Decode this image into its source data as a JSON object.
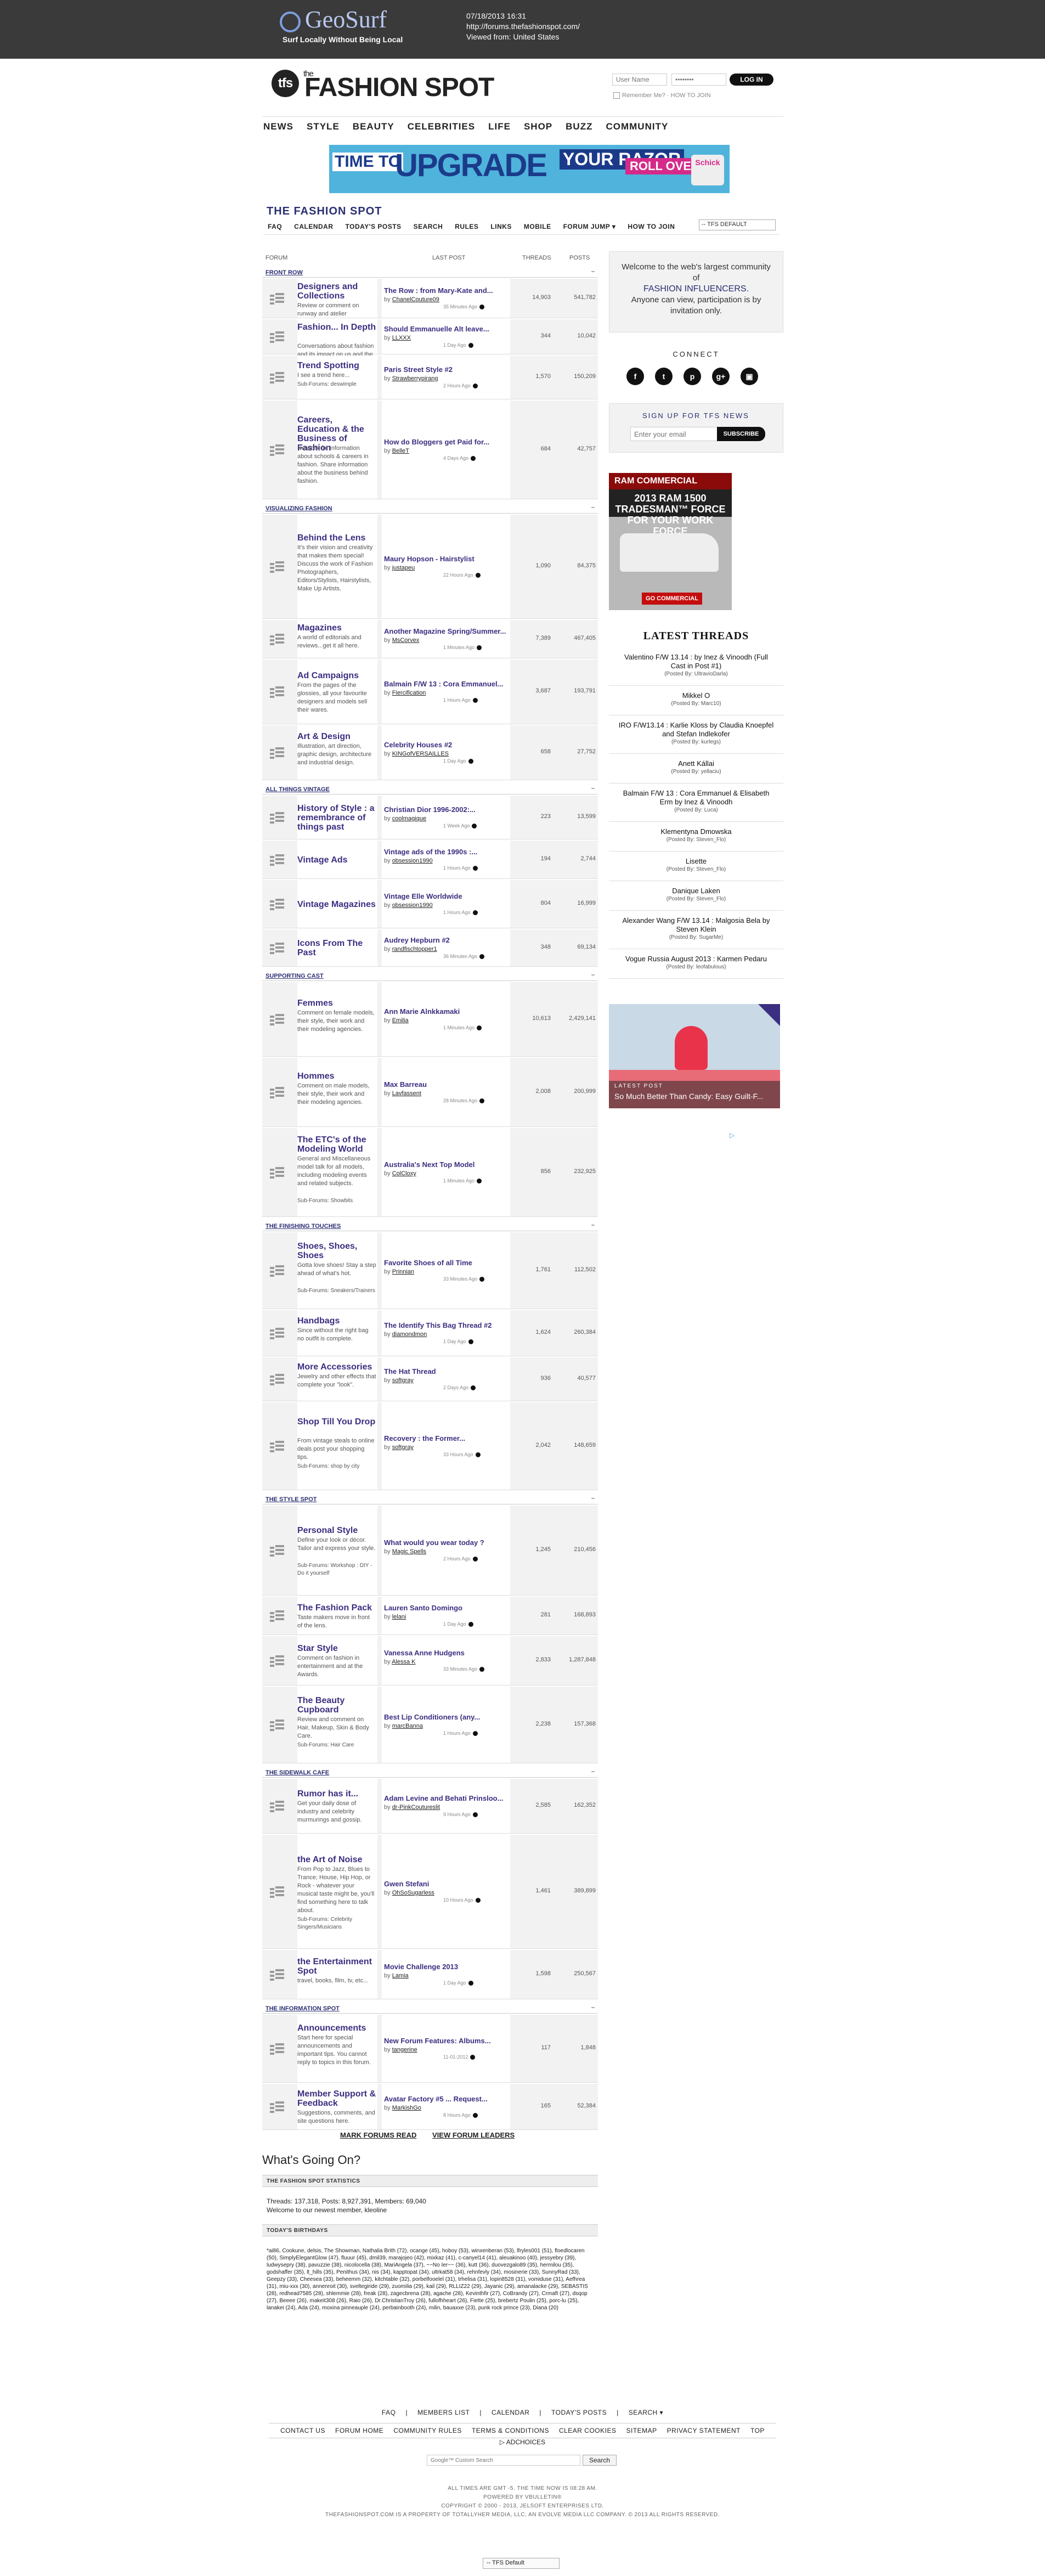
{
  "geosurf": {
    "name": "GeoSurf",
    "tagline": "Surf Locally Without Being Local",
    "timestamp": "07/18/2013 16:31",
    "url": "http://forums.thefashionspot.com/",
    "viewed_from": "Viewed from: United States"
  },
  "site": {
    "logo_small": "the",
    "logo_name": "FASHION SPOT",
    "user_placeholder": "User Name",
    "pass_placeholder": "••••••••",
    "login": "LOG IN",
    "remember": "Remember Me?",
    "how_to_join": "HOW TO JOIN"
  },
  "mainnav": [
    "NEWS",
    "STYLE",
    "BEAUTY",
    "CELEBRITIES",
    "LIFE",
    "SHOP",
    "BUZZ",
    "COMMUNITY"
  ],
  "ad": {
    "t1": "TIME TO",
    "t2": "UPGRADE",
    "t3": "YOUR RAZOR",
    "t4": "ROLL OVER",
    "t5": "Schick"
  },
  "forum_title": "THE FASHION SPOT",
  "forum_nav": [
    "FAQ",
    "CALENDAR",
    "TODAY'S POSTS",
    "SEARCH",
    "RULES",
    "LINKS",
    "MOBILE",
    "FORUM JUMP ▾",
    "HOW TO JOIN"
  ],
  "style_select": "-- TFS DEFAULT",
  "col_heads": {
    "forum": "FORUM",
    "last_post": "LAST POST",
    "threads": "THREADS",
    "posts": "POSTS"
  },
  "categories": [
    {
      "name": "FRONT ROW",
      "forums": [
        {
          "name": "Designers and Collections",
          "desc": "Review or comment on runway and atelier collections.",
          "sub": "",
          "lp_title": "The Row : from Mary-Kate and...",
          "lp_by": "ChanelCouture09",
          "lp_ago": "35 Minutes Ago",
          "threads": "14,903",
          "posts": "541,782"
        },
        {
          "name": "Fashion... In Depth",
          "desc": "Conversations about fashion and its impact on us and the world.",
          "sub": "",
          "lp_title": "Should Emmanuelle Alt leave...",
          "lp_by": "LLXXX",
          "lp_ago": "1 Day Ago",
          "threads": "344",
          "posts": "10,042"
        },
        {
          "name": "Trend Spotting",
          "desc": "I see a trend here...",
          "sub": "Sub-Forums:  deswimple",
          "lp_title": "Paris Street Style #2",
          "lp_by": "Strawberrypirang",
          "lp_ago": "2 Hours Ago",
          "threads": "1,570",
          "posts": "150,209"
        },
        {
          "name": "Careers, Education & the Business of Fashion",
          "desc": "Network for information about schools & careers in fashion. Share information about the business behind fashion.",
          "sub": "",
          "lp_title": "How do Bloggers get Paid for...",
          "lp_by": "BelleT",
          "lp_ago": "4 Days Ago",
          "threads": "684",
          "posts": "42,757"
        }
      ]
    },
    {
      "name": "VISUALIZING FASHION",
      "forums": [
        {
          "name": "Behind the Lens",
          "desc": "It's their vision and creativity that makes them special! Discuss the work of Fashion Photographers, Editors/Stylists, Hairstylists, Make Up Artists.",
          "sub": "",
          "lp_title": "Maury Hopson - Hairstylist",
          "lp_by": "justapeu",
          "lp_ago": "22 Hours Ago",
          "threads": "1,090",
          "posts": "84,375"
        },
        {
          "name": "Magazines",
          "desc": "A world of editorials and reviews...get it all here.",
          "sub": "",
          "lp_title": "Another Magazine Spring/Summer...",
          "lp_by": "MsCorvex",
          "lp_ago": "1 Minutes Ago",
          "threads": "7,389",
          "posts": "467,405"
        },
        {
          "name": "Ad Campaigns",
          "desc": "From the pages of the glossies, all your favourite designers and models sell their wares.",
          "sub": "",
          "lp_title": "Balmain F/W 13 : Cora Emmanuel...",
          "lp_by": "Fiercification",
          "lp_ago": "1 Hours Ago",
          "threads": "3,687",
          "posts": "193,791"
        },
        {
          "name": "Art & Design",
          "desc": "Illustration, art direction, graphic design, architecture and industrial design.",
          "sub": "",
          "lp_title": "Celebrity Houses #2",
          "lp_by": "KINGofVERSAILLES",
          "lp_ago": "1 Day Ago",
          "threads": "658",
          "posts": "27,752"
        }
      ]
    },
    {
      "name": "ALL THINGS VINTAGE",
      "forums": [
        {
          "name": "History of Style : a remembrance of things past",
          "desc": "",
          "sub": "",
          "lp_title": "Christian Dior 1996-2002:...",
          "lp_by": "coolmagique",
          "lp_ago": "1 Week Ago",
          "threads": "223",
          "posts": "13,599"
        },
        {
          "name": "Vintage Ads",
          "desc": "",
          "sub": "",
          "lp_title": "Vintage ads of the 1990s :...",
          "lp_by": "obsession1990",
          "lp_ago": "1 Hours Ago",
          "threads": "194",
          "posts": "2,744"
        },
        {
          "name": "Vintage Magazines",
          "desc": "",
          "sub": "",
          "lp_title": "Vintage Elle Worldwide",
          "lp_by": "obsession1990",
          "lp_ago": "1 Hours Ago",
          "threads": "804",
          "posts": "16,999"
        },
        {
          "name": "Icons From The Past",
          "desc": "",
          "sub": "",
          "lp_title": "Audrey Hepburn #2",
          "lp_by": "randfischtopper1",
          "lp_ago": "36 Minutes Ago",
          "threads": "348",
          "posts": "69,134"
        }
      ]
    },
    {
      "name": "SUPPORTING CAST",
      "forums": [
        {
          "name": "Femmes",
          "desc": "Comment on female models, their style, their work and their modeling agencies.",
          "sub": "",
          "lp_title": "Ann Marie Alnkkamaki",
          "lp_by": "Emilia",
          "lp_ago": "1 Minutes Ago",
          "threads": "10,613",
          "posts": "2,429,141"
        },
        {
          "name": "Hommes",
          "desc": "Comment on male models, their style, their work and their modeling agencies.",
          "sub": "",
          "lp_title": "Max Barreau",
          "lp_by": "Lavfassent",
          "lp_ago": "28 Minutes Ago",
          "threads": "2,008",
          "posts": "200,999"
        },
        {
          "name": "The ETC's of the Modeling World",
          "desc": "General and Miscellaneous model talk for all models, including modeling events and related subjects.",
          "sub": "Sub-Forums:  Showbits",
          "lp_title": "Australia's Next Top Model",
          "lp_by": "ColCloxy",
          "lp_ago": "1 Minutes Ago",
          "threads": "856",
          "posts": "232,925"
        }
      ]
    },
    {
      "name": "THE FINISHING TOUCHES",
      "forums": [
        {
          "name": "Shoes, Shoes, Shoes",
          "desc": "Gotta love shoes! Stay a step ahead of what's hot.",
          "sub": "Sub-Forums:  Sneakers/Trainers",
          "lp_title": "Favorite Shoes of all Time",
          "lp_by": "Prinnian",
          "lp_ago": "33 Minutes Ago",
          "threads": "1,761",
          "posts": "112,502"
        },
        {
          "name": "Handbags",
          "desc": "Since without the right bag no outfit is complete.",
          "sub": "",
          "lp_title": "The Identify This Bag Thread #2",
          "lp_by": "diamondmon",
          "lp_ago": "1 Day Ago",
          "threads": "1,624",
          "posts": "260,384"
        },
        {
          "name": "More Accessories",
          "desc": "Jewelry and other effects that complete your \"look\".",
          "sub": "",
          "lp_title": "The Hat Thread",
          "lp_by": "softgray",
          "lp_ago": "2 Days Ago",
          "threads": "936",
          "posts": "40,577"
        },
        {
          "name": "Shop Till You Drop",
          "desc": "From vintage steals to online deals post your shopping tips.",
          "sub": "Sub-Forums:  shop by city",
          "lp_title": "Recovery : the Former...",
          "lp_by": "softgray",
          "lp_ago": "33 Hours Ago",
          "threads": "2,042",
          "posts": "148,659"
        }
      ]
    },
    {
      "name": "THE STYLE SPOT",
      "forums": [
        {
          "name": "Personal Style",
          "desc": "Define your look or décor. Tailor and express your style.",
          "sub": "Sub-Forums:  Workshop : DIY - Do it yourself",
          "lp_title": "What would you wear today ?",
          "lp_by": "Magic Spells",
          "lp_ago": "2 Hours Ago",
          "threads": "1,245",
          "posts": "210,456"
        },
        {
          "name": "The Fashion Pack",
          "desc": "Taste makers move in front of the lens.",
          "sub": "",
          "lp_title": "Lauren Santo Domingo",
          "lp_by": "lelani",
          "lp_ago": "1 Day Ago",
          "threads": "281",
          "posts": "168,893"
        },
        {
          "name": "Star Style",
          "desc": "Comment on fashion in entertainment and at the Awards.",
          "sub": "",
          "lp_title": "Vanessa Anne Hudgens",
          "lp_by": "Alessa K",
          "lp_ago": "33 Minutes Ago",
          "threads": "2,833",
          "posts": "1,287,848"
        },
        {
          "name": "The Beauty Cupboard",
          "desc": "Review and comment on Hair, Makeup, Skin & Body Care.",
          "sub": "Sub-Forums:  Hair Care",
          "lp_title": "Best Lip Conditioners (any...",
          "lp_by": "marcBanna",
          "lp_ago": "1 Hours Ago",
          "threads": "2,238",
          "posts": "157,368"
        }
      ]
    },
    {
      "name": "THE SIDEWALK CAFE",
      "forums": [
        {
          "name": "Rumor has it...",
          "desc": "Get your daily dose of industry and celebrity murmurings and gossip.",
          "sub": "",
          "lp_title": "Adam Levine and Behati Prinsloo...",
          "lp_by": "dr-PinkCoutureslit",
          "lp_ago": "9 Hours Ago",
          "threads": "2,585",
          "posts": "162,352"
        },
        {
          "name": "the Art of Noise",
          "desc": "From Pop to Jazz, Blues to Trance; House, Hip Hop, or Rock - whatever your musical taste might be, you'll find something here to talk about.",
          "sub": "Sub-Forums:  Celebrity Singers/Musicians",
          "lp_title": "Gwen Stefani",
          "lp_by": "OhSoSugarless",
          "lp_ago": "10 Hours Ago",
          "threads": "1,461",
          "posts": "389,899"
        },
        {
          "name": "the Entertainment Spot",
          "desc": "travel, books, film, tv, etc...",
          "sub": "",
          "lp_title": "Movie Challenge 2013",
          "lp_by": "Lamia",
          "lp_ago": "1 Day Ago",
          "threads": "1,598",
          "posts": "250,567"
        }
      ]
    },
    {
      "name": "THE INFORMATION SPOT",
      "forums": [
        {
          "name": "Announcements",
          "desc": "Start here for special announcements and important tips. You cannot reply to topics in this forum.",
          "sub": "",
          "lp_title": "New Forum Features: Albums...",
          "lp_by": "tangerine",
          "lp_ago": "11-01-2012",
          "threads": "117",
          "posts": "1,848"
        },
        {
          "name": "Member Support & Feedback",
          "desc": "Suggestions, comments, and site questions here.",
          "sub": "",
          "lp_title": "Avatar Factory #5 ... Request...",
          "lp_by": "MarkishGo",
          "lp_ago": "8 Hours Ago",
          "threads": "165",
          "posts": "52,384"
        }
      ]
    }
  ],
  "sidebar": {
    "welcome_1": "Welcome to the web's largest community of",
    "welcome_2": "FASHION INFLUENCERS.",
    "welcome_3": "Anyone can view, participation is by invitation only.",
    "connect": "CONNECT",
    "social": [
      "f",
      "t",
      "p",
      "g+",
      "▣"
    ],
    "signup_title": "SIGN UP FOR TFS NEWS",
    "signup_placeholder": "Enter your email",
    "signup_btn": "SUBSCRIBE",
    "ram": {
      "t1": "RAM COMMERCIAL",
      "t2": "2013 RAM 1500 TRADESMAN™ FORCE FOR YOUR WORK FORCE",
      "t3": "GO COMMERCIAL"
    },
    "latest_title": "LATEST THREADS",
    "latest": [
      {
        "t": "Valentino F/W 13.14 : by Inez & Vinoodh (Full Cast in Post #1)",
        "by": "(Posted By: UltravioDarla)"
      },
      {
        "t": "Mikkel O",
        "by": "(Posted By: Marc10)"
      },
      {
        "t": "IRO F/W13.14 : Karlie Kloss by Claudia Knoepfel and Stefan Indlekofer",
        "by": "(Posted By: kurlegs)"
      },
      {
        "t": "Anett Kállai",
        "by": "(Posted By: yellaciu)"
      },
      {
        "t": "Balmain F/W 13 : Cora Emmanuel & Elisabeth Erm by Inez & Vinoodh",
        "by": "(Posted By: Luca)"
      },
      {
        "t": "Klementyna Dmowska",
        "by": "(Posted By: Steven_Flo)"
      },
      {
        "t": "Lisette",
        "by": "(Posted By: Steven_Flo)"
      },
      {
        "t": "Danique Laken",
        "by": "(Posted By: Steven_Flo)"
      },
      {
        "t": "Alexander Wang F/W 13.14 : Malgosia Bela by Steven Klein",
        "by": "(Posted By: SugarMe)"
      },
      {
        "t": "Vogue Russia August 2013 : Karmen Pedaru",
        "by": "(Posted By: leofabulous)"
      }
    ],
    "promo": {
      "label": "LATEST POST",
      "title": "So Much Better Than Candy: Easy Guilt-F..."
    },
    "adchoice": "▷"
  },
  "bottom": {
    "mark_read": "MARK FORUMS READ",
    "view_leaders": "VIEW FORUM LEADERS",
    "going_on": "What's Going On?",
    "stats_head": "THE FASHION SPOT STATISTICS",
    "stats_line": "Threads: 137,318, Posts: 8,927,391, Members: 69,040",
    "welcome_line": "Welcome to our newest member, kleoline",
    "bday_head": "TODAY'S BIRTHDAYS",
    "bdays": "*ai86, Cookune, delsis, The Showman, Nathalia Brith (72), ocange (45), hoboy (53), winxenberan (53), lfryles001 (51), floedlocaren (50), SimplyElegantGlow (47), fluuur (45), dmil39, marajojeo (42), mixkaz (41), c-canyel14 (41), aleuakinoo (40), jessyebry (39), ludwysepry (38), pavuzzie (38), nicolocella (38), MariAngela (37), ~~No Ier~~ (36), kutt (36), duovezgalo89 (35), hermilou (35), godshaffer (35), lt_hills (35), Penithus (34), nis (34), kapptopat (34), ultrkat58 (34), rehnfevly (34), mosinerie (33), SunnyRad (33), Geepzy (33), Cheesea (33), beheemm (32), kitchtable (32), porbelfooelel (31), trhelisa (31), lopin8528 (31), vomiduse (31), Aefhrea (31), miu-xxx (30), annenroit (30), sveltegiride (29), zuomilia (29), kail (29), RLLIZ22 (29), Jayanic (29), amanalacke (29), SEBASTIS (28), redhead7585 (28), shlemmie (28), freak (28), zagecbrena (28), agache (28), Kevinthfir (27), CoBrandy (27), Crmaft (27), dsqop (27), Beeee (26), makeit308 (26), Raio (26), Dr.ChristianTroy (26), fullofhheart (26), Fiette (25), brebertz Poulin (25), porc-lu (25), lanakei (24), Ada (24), moxina pinneauple (24), perbainbooth (24), milin, bauaxxe (23), punk rock prince (23), Diana (20)"
  },
  "footer": {
    "row1": [
      "FAQ",
      "|",
      "MEMBERS LIST",
      "|",
      "CALENDAR",
      "|",
      "TODAY'S POSTS",
      "|",
      "SEARCH ▾"
    ],
    "row2": [
      "CONTACT US",
      "FORUM HOME",
      "COMMUNITY RULES",
      "TERMS & CONDITIONS",
      "CLEAR COOKIES",
      "SITEMAP",
      "PRIVACY STATEMENT",
      "TOP"
    ],
    "adchoices": "▷ ADCHOICES",
    "search_placeholder": "Google™ Custom Search",
    "search_btn": "Search",
    "n1": "ALL TIMES ARE GMT -5. THE TIME NOW IS 08:28 AM.",
    "n2": "POWERED BY VBULLETIN®",
    "n3": "COPYRIGHT © 2000 - 2013, JELSOFT ENTERPRISES LTD.",
    "n4": "THEFASHIONSPOT.COM IS A PROPERTY OF TOTALLYHER MEDIA, LLC, AN EVOLVE MEDIA LLC COMPANY. © 2013 ALL RIGHTS RESERVED.",
    "style": "-- TFS Default"
  }
}
